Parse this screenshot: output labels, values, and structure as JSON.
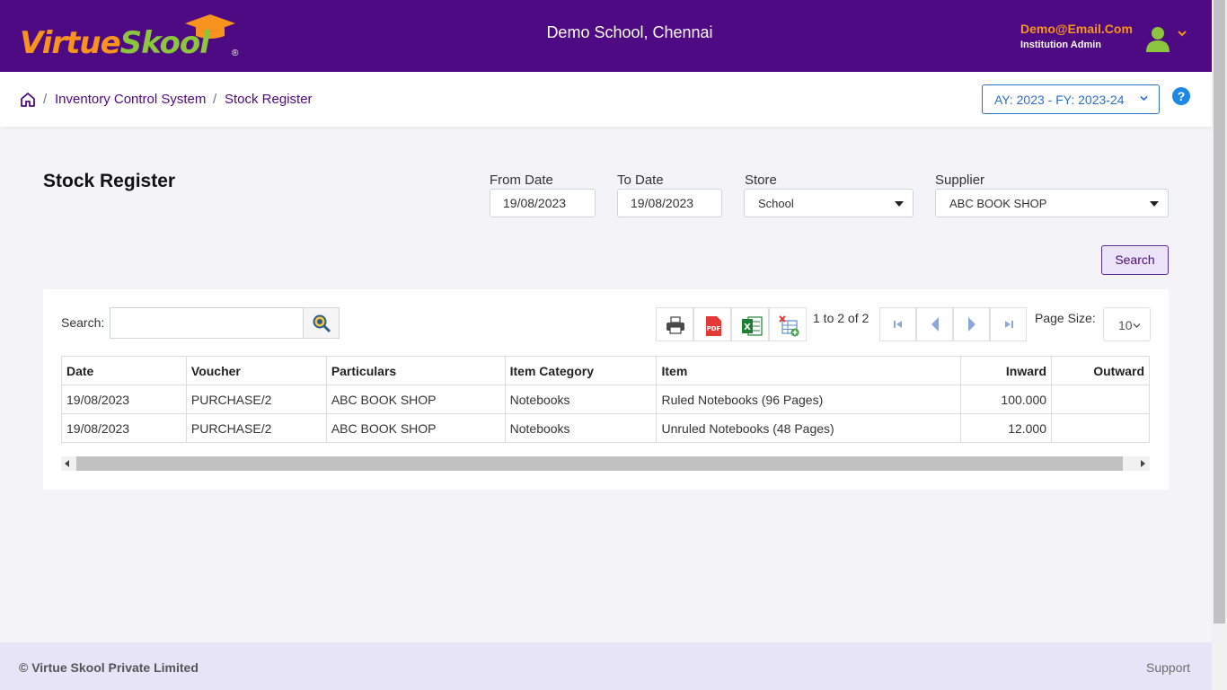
{
  "header": {
    "brand_part1": "Virtue",
    "brand_part2": "Skool",
    "brand_reg": "®",
    "school": "Demo School, Chennai",
    "user_email": "Demo@Email.Com",
    "user_role": "Institution Admin",
    "bg_color": "#4e0a82"
  },
  "breadcrumb": {
    "items": [
      "Inventory Control System",
      "Stock Register"
    ],
    "separator": "/"
  },
  "academic_year": "AY: 2023 - FY: 2023-24",
  "help_label": "?",
  "page": {
    "title": "Stock Register"
  },
  "filters": {
    "from_date_label": "From Date",
    "from_date": "19/08/2023",
    "to_date_label": "To Date",
    "to_date": "19/08/2023",
    "store_label": "Store",
    "store": "School",
    "supplier_label": "Supplier",
    "supplier": "ABC BOOK SHOP",
    "search_button": "Search"
  },
  "grid": {
    "search_label": "Search:",
    "search_value": "",
    "record_count": "1 to 2 of 2",
    "page_size_label": "Page Size:",
    "page_size": "10",
    "columns": [
      "Date",
      "Voucher",
      "Particulars",
      "Item Category",
      "Item",
      "Inward",
      "Outward"
    ],
    "rows": [
      [
        "19/08/2023",
        "PURCHASE/2",
        "ABC BOOK SHOP",
        "Notebooks",
        "Ruled Notebooks (96 Pages)",
        "100.000",
        ""
      ],
      [
        "19/08/2023",
        "PURCHASE/2",
        "ABC BOOK SHOP",
        "Notebooks",
        "Unruled Notebooks (48 Pages)",
        "12.000",
        ""
      ]
    ]
  },
  "footer": {
    "copyright": "© Virtue Skool Private Limited",
    "support": "Support"
  }
}
